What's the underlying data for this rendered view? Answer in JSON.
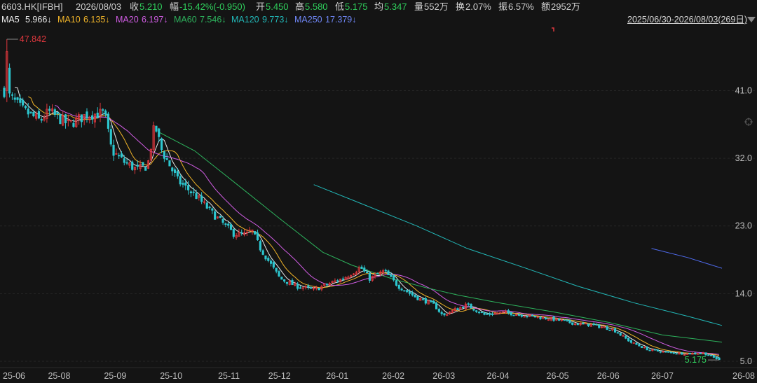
{
  "header": {
    "symbol": "6603.HK[IFBH]",
    "date": "2026/08/03",
    "close_label": "收",
    "close": "5.210",
    "change_label": "幅",
    "change": "-15.42%(-0.950)",
    "open_label": "开",
    "open": "5.450",
    "high_label": "高",
    "high": "5.580",
    "low_label": "低",
    "low": "5.175",
    "avg_label": "均",
    "avg": "5.347",
    "volume_label": "量",
    "volume": "552万",
    "turnover_label": "换",
    "turnover": "2.07%",
    "amplitude_label": "振",
    "amplitude": "6.57%",
    "amount_label": "额",
    "amount": "2952万"
  },
  "ma_bar": {
    "ma5_label": "MA5",
    "ma5": "5.966↓",
    "ma10_label": "MA10",
    "ma10": "6.135↓",
    "ma20_label": "MA20",
    "ma20": "6.197↓",
    "ma60_label": "MA60",
    "ma60": "7.546↓",
    "ma120_label": "MA120",
    "ma120": "9.773↓",
    "ma250_label": "MA250",
    "ma250": "17.379↓",
    "range": "2025/06/30-2026/08/03(269日)"
  },
  "colors": {
    "up": "#e0383e",
    "down": "#2dc6cf",
    "ma5": "#e9e9e9",
    "ma10": "#f0b429",
    "ma20": "#d05ce3",
    "ma60": "#2db35d",
    "ma120": "#22b8b8",
    "ma250": "#4f6bed",
    "header_green": "#2fcf5c",
    "header_red": "#e0383e"
  },
  "chart_data": {
    "type": "candlestick",
    "ylim": [
      5.0,
      47.842
    ],
    "yticks": [
      41.0,
      32.0,
      23.0,
      14.0,
      5.0
    ],
    "xticks": [
      "25-06",
      "25-08",
      "25-09",
      "25-10",
      "25-11",
      "25-12",
      "26-01",
      "26-02",
      "26-03",
      "26-04",
      "26-05",
      "26-06",
      "26-07",
      "26-08"
    ],
    "max_label": "47.842",
    "min_label": "5.175",
    "anchors": [
      [
        "2025-06-30",
        41.0
      ],
      [
        "2025-07-01",
        46.5
      ],
      [
        "2025-07-02",
        40.5
      ],
      [
        "2025-07-10",
        38.5
      ],
      [
        "2025-07-20",
        37.0
      ],
      [
        "2025-07-25",
        38.2
      ],
      [
        "2025-08-05",
        36.5
      ],
      [
        "2025-08-15",
        37.8
      ],
      [
        "2025-08-25",
        38.0
      ],
      [
        "2025-08-29",
        33.0
      ],
      [
        "2025-09-05",
        31.5
      ],
      [
        "2025-09-12",
        30.5
      ],
      [
        "2025-09-18",
        31.0
      ],
      [
        "2025-09-22",
        36.5
      ],
      [
        "2025-09-26",
        33.0
      ],
      [
        "2025-10-05",
        29.0
      ],
      [
        "2025-10-15",
        27.0
      ],
      [
        "2025-10-25",
        24.5
      ],
      [
        "2025-11-05",
        22.0
      ],
      [
        "2025-11-12",
        21.8
      ],
      [
        "2025-11-15",
        22.5
      ],
      [
        "2025-11-20",
        20.0
      ],
      [
        "2025-12-01",
        16.0
      ],
      [
        "2025-12-10",
        15.0
      ],
      [
        "2025-12-20",
        14.5
      ],
      [
        "2025-12-30",
        15.5
      ],
      [
        "2026-01-05",
        16.0
      ],
      [
        "2026-01-15",
        17.5
      ],
      [
        "2026-01-20",
        16.0
      ],
      [
        "2026-01-28",
        17.0
      ],
      [
        "2026-02-05",
        15.0
      ],
      [
        "2026-02-15",
        13.5
      ],
      [
        "2026-02-25",
        12.5
      ],
      [
        "2026-03-02",
        11.0
      ],
      [
        "2026-03-05",
        11.5
      ],
      [
        "2026-03-15",
        12.5
      ],
      [
        "2026-03-25",
        11.2
      ],
      [
        "2026-04-05",
        11.5
      ],
      [
        "2026-04-20",
        11.0
      ],
      [
        "2026-05-05",
        10.5
      ],
      [
        "2026-05-15",
        10.0
      ],
      [
        "2026-05-25",
        9.8
      ],
      [
        "2026-06-05",
        9.2
      ],
      [
        "2026-06-15",
        7.5
      ],
      [
        "2026-06-25",
        6.5
      ],
      [
        "2026-07-05",
        6.2
      ],
      [
        "2026-07-15",
        6.0
      ],
      [
        "2026-07-25",
        6.1
      ],
      [
        "2026-08-03",
        5.21
      ]
    ],
    "series": [
      {
        "name": "MA60",
        "values": [
          [
            "2025-09-25",
            35.5
          ],
          [
            "2025-10-15",
            33.0
          ],
          [
            "2025-11-05",
            29.0
          ],
          [
            "2025-12-01",
            24.0
          ],
          [
            "2025-12-25",
            19.5
          ],
          [
            "2026-01-10",
            17.8
          ],
          [
            "2026-02-01",
            16.0
          ],
          [
            "2026-02-20",
            14.8
          ],
          [
            "2026-03-10",
            13.8
          ],
          [
            "2026-04-01",
            12.8
          ],
          [
            "2026-05-01",
            11.6
          ],
          [
            "2026-06-01",
            10.2
          ],
          [
            "2026-07-01",
            8.5
          ],
          [
            "2026-08-03",
            7.55
          ]
        ]
      },
      {
        "name": "MA120",
        "values": [
          [
            "2025-12-20",
            28.5
          ],
          [
            "2026-01-15",
            26.0
          ],
          [
            "2026-02-15",
            23.0
          ],
          [
            "2026-03-15",
            20.0
          ],
          [
            "2026-04-15",
            17.5
          ],
          [
            "2026-05-15",
            15.0
          ],
          [
            "2026-06-15",
            12.8
          ],
          [
            "2026-07-15",
            11.0
          ],
          [
            "2026-08-03",
            9.77
          ]
        ]
      },
      {
        "name": "MA250",
        "values": [
          [
            "2026-06-25",
            20.0
          ],
          [
            "2026-07-15",
            18.8
          ],
          [
            "2026-08-03",
            17.38
          ]
        ]
      }
    ]
  }
}
